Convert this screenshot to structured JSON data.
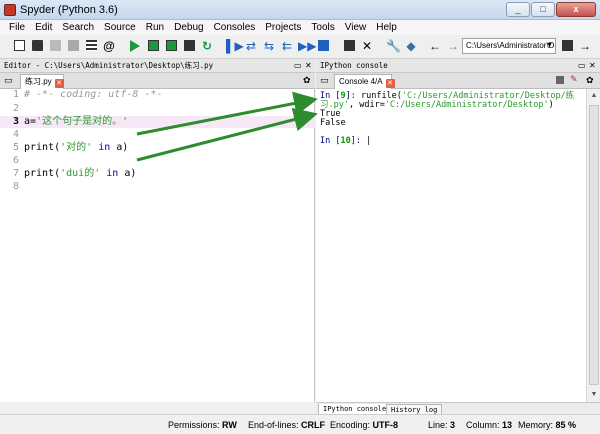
{
  "window": {
    "title": "Spyder (Python 3.6)",
    "min": "_",
    "max": "□",
    "close": "x"
  },
  "menu": [
    "File",
    "Edit",
    "Search",
    "Source",
    "Run",
    "Debug",
    "Consoles",
    "Projects",
    "Tools",
    "View",
    "Help"
  ],
  "toolbar": {
    "working_dir": "C:\\Users\\Administrator\\Desktop"
  },
  "editor": {
    "header": "Editor - C:\\Users\\Administrator\\Desktop\\练习.py",
    "tab_label": "练习.py",
    "lines": [
      {
        "num": "1",
        "parts": [
          {
            "cls": "c-comment",
            "text": "# -*- coding: utf-8 -*-"
          }
        ]
      },
      {
        "num": "2",
        "parts": []
      },
      {
        "num": "3",
        "parts": [
          {
            "cls": "c-var",
            "text": "a="
          },
          {
            "cls": "c-str",
            "text": "'这个句子是对的。'"
          }
        ]
      },
      {
        "num": "4",
        "parts": []
      },
      {
        "num": "5",
        "parts": [
          {
            "cls": "c-var",
            "text": "print("
          },
          {
            "cls": "c-str",
            "text": "'对的'"
          },
          {
            "cls": "c-var",
            "text": " "
          },
          {
            "cls": "c-kw",
            "text": "in"
          },
          {
            "cls": "c-var",
            "text": " a)"
          }
        ]
      },
      {
        "num": "6",
        "parts": []
      },
      {
        "num": "7",
        "parts": [
          {
            "cls": "c-var",
            "text": "print("
          },
          {
            "cls": "c-str",
            "text": "'dui的'"
          },
          {
            "cls": "c-var",
            "text": " "
          },
          {
            "cls": "c-kw",
            "text": "in"
          },
          {
            "cls": "c-var",
            "text": " a)"
          }
        ]
      },
      {
        "num": "8",
        "parts": []
      }
    ]
  },
  "console": {
    "header": "IPython console",
    "tab_label": "Console 4/A",
    "lines": [
      [
        {
          "cls": "c-in",
          "text": "In ["
        },
        {
          "cls": "c-inn",
          "text": "9"
        },
        {
          "cls": "c-in",
          "text": "]: "
        },
        {
          "cls": "c-var",
          "text": "runfile("
        },
        {
          "cls": "c-cstr",
          "text": "'C:/Users/Administrator/Desktop/练"
        }
      ],
      [
        {
          "cls": "c-cstr",
          "text": "习.py'"
        },
        {
          "cls": "c-var",
          "text": ", wdir="
        },
        {
          "cls": "c-cstr",
          "text": "'C:/Users/Administrator/Desktop'"
        },
        {
          "cls": "c-var",
          "text": ")"
        }
      ],
      [
        {
          "cls": "c-var",
          "text": "True"
        }
      ],
      [
        {
          "cls": "c-var",
          "text": "False"
        }
      ],
      [],
      [
        {
          "cls": "c-in",
          "text": "In ["
        },
        {
          "cls": "c-inn",
          "text": "10"
        },
        {
          "cls": "c-in",
          "text": "]: "
        }
      ]
    ],
    "bottom_tabs": [
      "IPython console",
      "History log"
    ]
  },
  "status": {
    "permissions_label": "Permissions:",
    "permissions": "RW",
    "eol_label": "End-of-lines:",
    "eol": "CRLF",
    "encoding_label": "Encoding:",
    "encoding": "UTF-8",
    "line_label": "Line:",
    "line": "3",
    "column_label": "Column:",
    "column": "13",
    "memory_label": "Memory:",
    "memory": "85 %"
  },
  "colors": {
    "arrow": "#2e8b2e",
    "accent_run": "#1a9a3a",
    "string": "#2a9a2a",
    "keyword": "#0000c0"
  }
}
